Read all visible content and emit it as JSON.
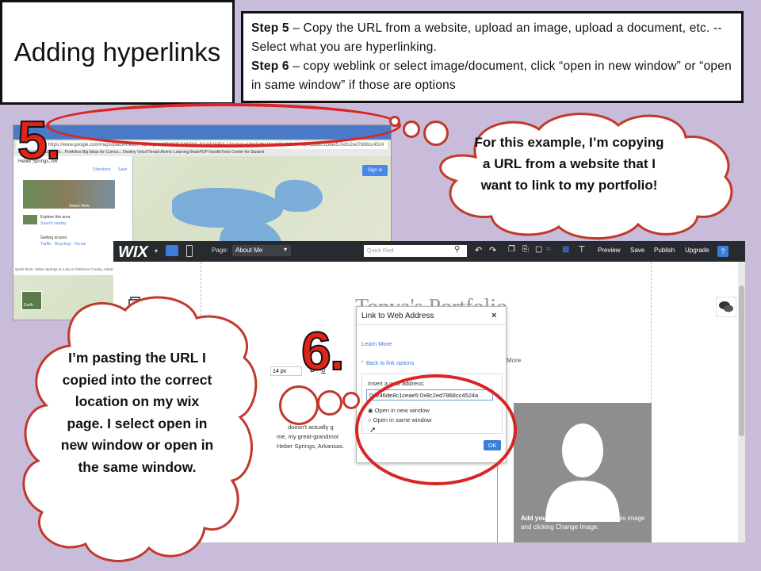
{
  "slide": {
    "title": "Adding hyperlinks",
    "step5_label": "Step 5",
    "step5_text": " – Copy the URL from a website, upload an image, upload a document, etc.  -- Select what you are hyperlinking.",
    "step6_label": "Step 6",
    "step6_text": " – copy weblink or select image/document, click “open in new window” or “open in same window” if those are options",
    "marker_5": "5.",
    "marker_6": "6."
  },
  "callouts": {
    "top_right": "For this example, I’m copying a URL from a website that I want to link to my portfolio!",
    "left": "I’m pasting the URL I copied into the correct location on my wix page. I select open in new window or open in the same window."
  },
  "browser": {
    "address": "https://www.google.com/maps/place/Heber+Springs,+AR/@35.506734,-92.0428354,13z/data=!3m1!4b1!4m2!3m1!1s0x0d246de8c1ceae5:0x8c2ed7868cc4524",
    "bookmarks": "Apps   Faculty Access for...   Portfolios   Big Ideas for Curricu...   Destiny   VoiceThread   Atomic Learning   BrainPOP   NoodleTools   Center for Student",
    "place": "Heber Springs, AR",
    "directions": "Directions",
    "save": "Save",
    "street_view": "Street View",
    "explore": "Explore this area",
    "search_nearby": "Search nearby",
    "getting_around": "Getting around",
    "traffic": "Traffic · Bicycling · Terrain",
    "quick_facts": "Quick facts: Heber Springs is a city in Cleburne County, Arkansas",
    "sign_in": "Sign in",
    "earth": "Earth"
  },
  "wix": {
    "logo": "WIX",
    "page_label": "Page:",
    "page_value": "About Me",
    "search_placeholder": "Quick Find",
    "preview": "Preview",
    "save": "Save",
    "publish": "Publish",
    "upgrade": "Upgrade",
    "help": "?",
    "more": "More",
    "font_size": "14 px",
    "portfolio_heading": "Tonya's Portfolio",
    "bg_text_1": "doesn't actually g",
    "bg_text_2": "me, my great-grandmot",
    "bg_text_3": "Heber Springs, Arkansas.",
    "image_text_bold": "Add your own image",
    "image_text": " by clicking this image and clicking Change Image."
  },
  "dialog": {
    "title": "Link to Web Address",
    "close": "×",
    "learn_more": "Learn More",
    "back": "Back to link options",
    "label": "Insert a web address:",
    "value": "0d246de8c1ceae5:0x8c2ed7868cc4524a",
    "option_new": "Open in new window",
    "option_same": "Open in same window",
    "ok": "OK"
  },
  "colors": {
    "background": "#c9bcda",
    "accent_red": "#d92525",
    "wix_bar": "#272b30",
    "wix_blue": "#3b7dd8"
  }
}
